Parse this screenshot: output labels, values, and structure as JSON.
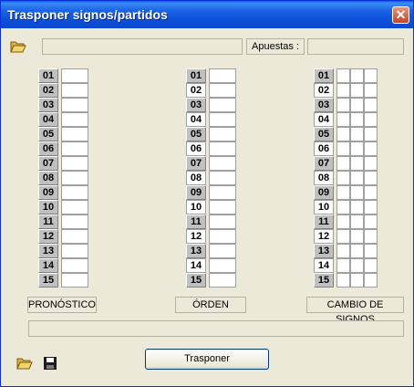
{
  "window": {
    "title": "Trasponer signos/partidos",
    "close_symbol": "✕"
  },
  "top": {
    "apuestas_label": "Apuestas :"
  },
  "rows": [
    "01",
    "02",
    "03",
    "04",
    "05",
    "06",
    "07",
    "08",
    "09",
    "10",
    "11",
    "12",
    "13",
    "14",
    "15"
  ],
  "groups": {
    "pronostico": "PRONÓSTICO",
    "orden": "ÓRDEN",
    "cambio": "CAMBIO DE SIGNOS"
  },
  "footer": {
    "button_label": "Trasponer"
  },
  "icons": [
    "open-folder-icon",
    "save-icon"
  ]
}
